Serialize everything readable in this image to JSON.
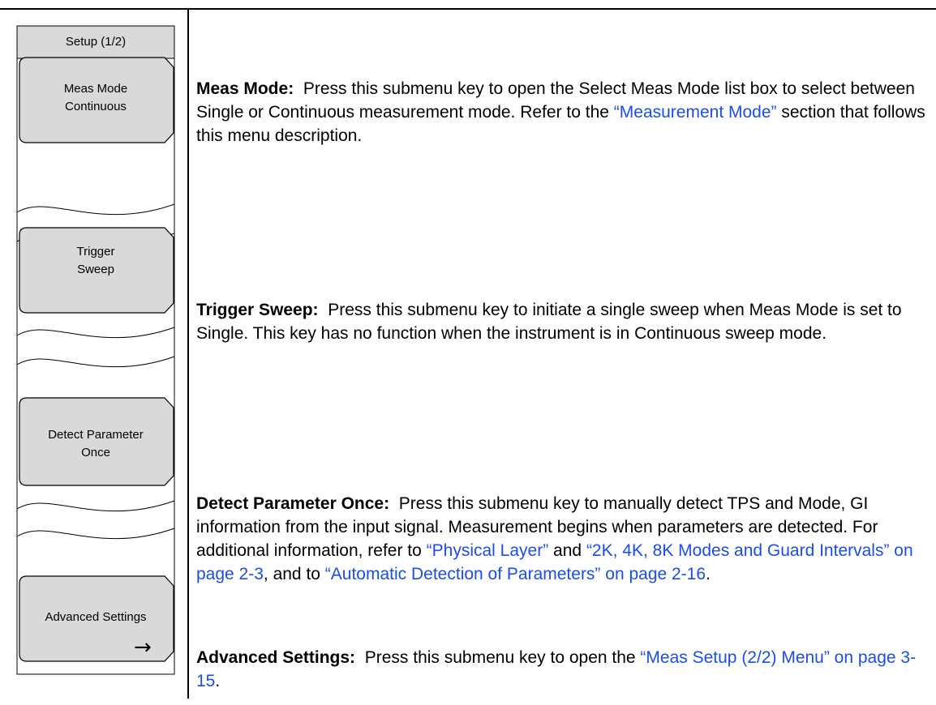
{
  "menu": {
    "title": "Setup (1/2)",
    "keys": [
      {
        "line1": "Meas Mode",
        "line2": "Continuous"
      },
      {
        "line1": "Trigger",
        "line2": "Sweep"
      },
      {
        "line1": "Detect Parameter",
        "line2": "Once"
      },
      {
        "line1": "Advanced Settings",
        "arrow": "→"
      }
    ]
  },
  "descriptions": {
    "meas_mode": {
      "term": "Meas Mode:",
      "text1": "Press this submenu key to open the Select Meas Mode list box to select between Single or Continuous measurement mode. Refer to the ",
      "link1": "“Measurement Mode”",
      "text2": " section that follows this menu description."
    },
    "trigger_sweep": {
      "term": "Trigger Sweep:",
      "text1": "Press this submenu key to initiate a single sweep when Meas Mode is set to Single. This key has no function when the instrument is in Continuous sweep mode."
    },
    "detect_parameter": {
      "term": "Detect Parameter Once:",
      "text1": "Press this submenu key to manually detect TPS and Mode, GI information from the input signal. Measurement begins when parameters are detected. For additional information, refer to ",
      "link1": "“Physical Layer”",
      "text2": " and ",
      "link2": "“2K, 4K, 8K Modes and Guard Intervals” on page 2-3",
      "text3": ", and to ",
      "link3": "“Automatic Detection of Parameters” on page 2-16",
      "text4": "."
    },
    "advanced_settings": {
      "term": "Advanced Settings:",
      "text1": "Press this submenu key to open the ",
      "link1": "“Meas Setup (2/2) Menu” on page 3-15",
      "text2": "."
    }
  },
  "colors": {
    "link": "#1a4ee6",
    "key_fill": "#d9d9d9",
    "title_fill": "#d9d9d9"
  }
}
